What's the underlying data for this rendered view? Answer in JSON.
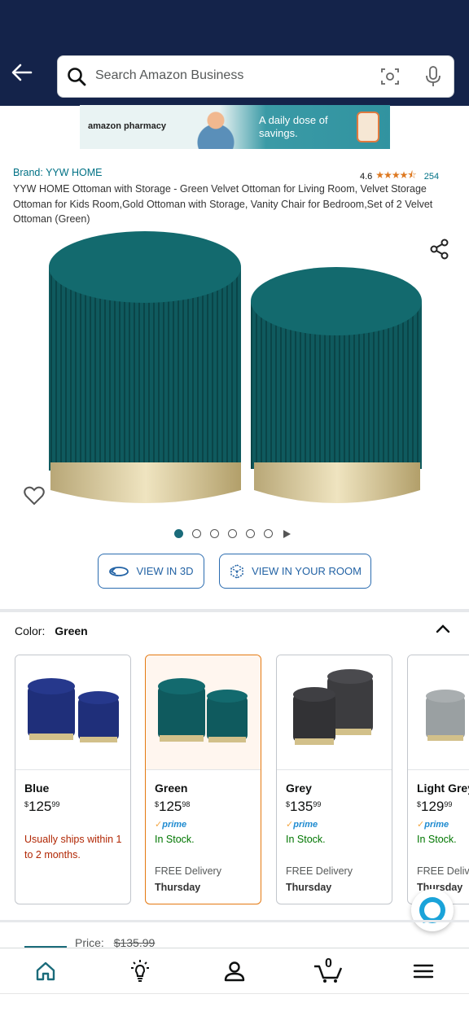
{
  "search": {
    "placeholder": "Search Amazon Business"
  },
  "banner": {
    "brand": "amazon pharmacy",
    "tagline": "A daily dose of savings."
  },
  "product": {
    "brand_link": "Brand: YYW HOME",
    "rating_value": "4.6",
    "rating_stars": 4.5,
    "rating_count": "254",
    "title": "YYW HOME Ottoman with Storage - Green Velvet Ottoman for Living Room, Velvet Storage Ottoman for Kids Room,Gold Ottoman with Storage, Vanity Chair for Bedroom,Set of 2 Velvet Ottoman (Green)",
    "image_count": 6,
    "active_image": 0,
    "view_3d_label": "VIEW IN 3D",
    "view_room_label": "VIEW IN YOUR ROOM"
  },
  "variations": {
    "label": "Color:",
    "selected": "Green",
    "options": [
      {
        "name": "Blue",
        "currency": "$",
        "dollars": "125",
        "cents": "99",
        "prime": false,
        "availability": "Usually ships within 1 to 2 months.",
        "delivery": "",
        "day": "",
        "color": "#1f2f7a"
      },
      {
        "name": "Green",
        "currency": "$",
        "dollars": "125",
        "cents": "98",
        "prime": true,
        "availability": "In Stock.",
        "delivery": "FREE Delivery",
        "day": "Thursday",
        "color": "#0f5a5e"
      },
      {
        "name": "Grey",
        "currency": "$",
        "dollars": "135",
        "cents": "99",
        "prime": true,
        "availability": "In Stock.",
        "delivery": "FREE Delivery",
        "day": "Thursday",
        "color": "#3c3c3f"
      },
      {
        "name": "Light Grey",
        "currency": "$",
        "dollars": "129",
        "cents": "99",
        "prime": true,
        "availability": "In Stock.",
        "delivery": "FREE Delivery",
        "day": "Thursday",
        "color": "#9aa0a2"
      }
    ],
    "prime_label": "prime"
  },
  "price_peek": {
    "label": "Price:",
    "value": "$135.99"
  },
  "nav": {
    "cart_count": "0"
  },
  "colors": {
    "header": "#14234a",
    "link": "#007185",
    "accent": "#e47911",
    "teal": "#1a6b7a",
    "stock": "#007600",
    "warning": "#b12704"
  }
}
